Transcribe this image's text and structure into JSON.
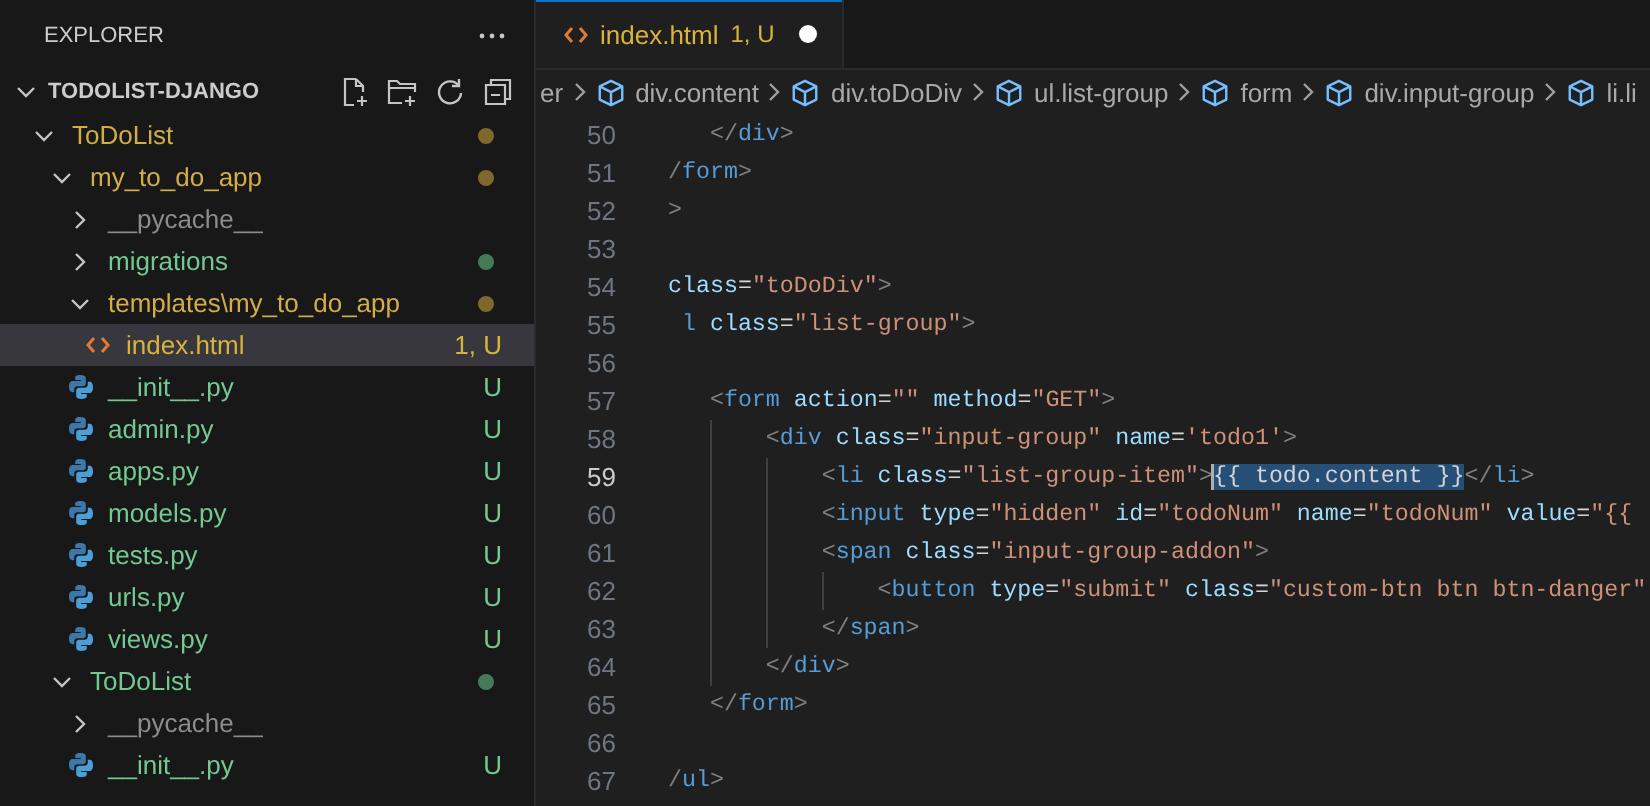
{
  "sidebar": {
    "title": "EXPLORER",
    "section": {
      "title": "TODOLIST-DJANGO",
      "expanded": true
    },
    "tree": [
      {
        "name": "ToDoList",
        "kind": "folder",
        "color": "#d2ad48",
        "expanded": true,
        "selected": false,
        "dot": true,
        "children": [
          {
            "name": "my_to_do_app",
            "kind": "folder",
            "color": "#d2ad48",
            "expanded": true,
            "selected": false,
            "dot": true,
            "children": [
              {
                "name": "__pycache__",
                "kind": "folder",
                "color": "#8c8c8c",
                "expanded": false,
                "selected": false,
                "dot": false
              },
              {
                "name": "migrations",
                "kind": "folder",
                "color": "#73c991",
                "expanded": false,
                "selected": false,
                "dot": true
              },
              {
                "name": "templates\\my_to_do_app",
                "kind": "folder",
                "color": "#d2ad48",
                "expanded": true,
                "selected": false,
                "dot": true,
                "children": [
                  {
                    "name": "index.html",
                    "kind": "html",
                    "color": "#d9b33c",
                    "selected": true,
                    "badge": "1, U"
                  }
                ]
              },
              {
                "name": "__init__.py",
                "kind": "python",
                "color": "#73c991",
                "selected": false,
                "badge": "U"
              },
              {
                "name": "admin.py",
                "kind": "python",
                "color": "#73c991",
                "selected": false,
                "badge": "U"
              },
              {
                "name": "apps.py",
                "kind": "python",
                "color": "#73c991",
                "selected": false,
                "badge": "U"
              },
              {
                "name": "models.py",
                "kind": "python",
                "color": "#73c991",
                "selected": false,
                "badge": "U"
              },
              {
                "name": "tests.py",
                "kind": "python",
                "color": "#73c991",
                "selected": false,
                "badge": "U"
              },
              {
                "name": "urls.py",
                "kind": "python",
                "color": "#73c991",
                "selected": false,
                "badge": "U"
              },
              {
                "name": "views.py",
                "kind": "python",
                "color": "#73c991",
                "selected": false,
                "badge": "U"
              }
            ]
          },
          {
            "name": "ToDoList",
            "kind": "folder",
            "color": "#73c991",
            "expanded": true,
            "selected": false,
            "dot": true,
            "children": [
              {
                "name": "__pycache__",
                "kind": "folder",
                "color": "#8c8c8c",
                "expanded": false,
                "selected": false,
                "dot": false
              },
              {
                "name": "__init__.py",
                "kind": "python",
                "color": "#73c991",
                "selected": false,
                "badge": "U"
              }
            ]
          }
        ]
      }
    ]
  },
  "tabs": [
    {
      "name": "index.html",
      "badge": "1, U",
      "color": "#d9b33c",
      "modified": true,
      "selected": true
    }
  ],
  "breadcrumbs": [
    {
      "text": "er",
      "icon": false
    },
    {
      "text": "div.content",
      "icon": true
    },
    {
      "text": "div.toDoDiv",
      "icon": true
    },
    {
      "text": "ul.list-group",
      "icon": true
    },
    {
      "text": "form",
      "icon": true
    },
    {
      "text": "div.input-group",
      "icon": true
    },
    {
      "text": "li.li",
      "icon": true
    }
  ],
  "editor": {
    "lines": [
      {
        "number": "50",
        "active": false,
        "tokens": [
          {
            "kind": "punct",
            "text": "   </"
          },
          {
            "kind": "tag",
            "text": "div"
          },
          {
            "kind": "punct",
            "text": ">"
          }
        ]
      },
      {
        "number": "51",
        "active": false,
        "tokens": [
          {
            "kind": "punct",
            "text": "/"
          },
          {
            "kind": "tag",
            "text": "form"
          },
          {
            "kind": "punct",
            "text": ">"
          }
        ]
      },
      {
        "number": "52",
        "active": false,
        "tokens": [
          {
            "kind": "punct",
            "text": ">"
          }
        ]
      },
      {
        "number": "53",
        "active": false
      },
      {
        "number": "54",
        "active": false,
        "tokens": [
          {
            "kind": "attr",
            "text": "class"
          },
          {
            "kind": "plain",
            "text": "="
          },
          {
            "kind": "string",
            "text": "\"toDoDiv\""
          },
          {
            "kind": "punct",
            "text": ">"
          }
        ]
      },
      {
        "number": "55",
        "active": false,
        "tokens": [
          {
            "kind": "tag",
            "text": " l"
          },
          {
            "kind": "attr",
            "text": " class"
          },
          {
            "kind": "plain",
            "text": "="
          },
          {
            "kind": "string",
            "text": "\"list-group\""
          },
          {
            "kind": "punct",
            "text": ">"
          }
        ]
      },
      {
        "number": "56",
        "active": false
      },
      {
        "number": "57",
        "active": false,
        "tokens": [
          {
            "kind": "punct",
            "text": "   <"
          },
          {
            "kind": "tag",
            "text": "form"
          },
          {
            "kind": "attr",
            "text": " action"
          },
          {
            "kind": "plain",
            "text": "="
          },
          {
            "kind": "string",
            "text": "\"\""
          },
          {
            "kind": "attr",
            "text": " method"
          },
          {
            "kind": "plain",
            "text": "="
          },
          {
            "kind": "string",
            "text": "\"GET\""
          },
          {
            "kind": "punct",
            "text": ">"
          }
        ]
      },
      {
        "number": "58",
        "active": false,
        "tokens": [
          {
            "kind": "punct",
            "text": "       <"
          },
          {
            "kind": "tag",
            "text": "div"
          },
          {
            "kind": "attr",
            "text": " class"
          },
          {
            "kind": "plain",
            "text": "="
          },
          {
            "kind": "string",
            "text": "\"input-group\""
          },
          {
            "kind": "attr",
            "text": " name"
          },
          {
            "kind": "plain",
            "text": "="
          },
          {
            "kind": "string",
            "text": "'todo1'"
          },
          {
            "kind": "punct",
            "text": ">"
          }
        ]
      },
      {
        "number": "59",
        "active": true,
        "tokens": [
          {
            "kind": "punct",
            "text": "           <"
          },
          {
            "kind": "tag",
            "text": "li"
          },
          {
            "kind": "attr",
            "text": " class"
          },
          {
            "kind": "plain",
            "text": "="
          },
          {
            "kind": "string",
            "text": "\"list-group-item\""
          },
          {
            "kind": "punct",
            "text": ">"
          },
          {
            "kind": "selection",
            "text": "{{ todo.content }}"
          },
          {
            "kind": "punct",
            "text": "</"
          },
          {
            "kind": "tag",
            "text": "li"
          },
          {
            "kind": "punct",
            "text": ">"
          }
        ]
      },
      {
        "number": "60",
        "active": false,
        "tokens": [
          {
            "kind": "punct",
            "text": "           <"
          },
          {
            "kind": "tag",
            "text": "input"
          },
          {
            "kind": "attr",
            "text": " type"
          },
          {
            "kind": "plain",
            "text": "="
          },
          {
            "kind": "string",
            "text": "\"hidden\""
          },
          {
            "kind": "attr",
            "text": " id"
          },
          {
            "kind": "plain",
            "text": "="
          },
          {
            "kind": "string",
            "text": "\"todoNum\""
          },
          {
            "kind": "attr",
            "text": " name"
          },
          {
            "kind": "plain",
            "text": "="
          },
          {
            "kind": "string",
            "text": "\"todoNum\""
          },
          {
            "kind": "attr",
            "text": " value"
          },
          {
            "kind": "plain",
            "text": "="
          },
          {
            "kind": "string",
            "text": "\"{{"
          }
        ]
      },
      {
        "number": "61",
        "active": false,
        "tokens": [
          {
            "kind": "punct",
            "text": "           <"
          },
          {
            "kind": "tag",
            "text": "span"
          },
          {
            "kind": "attr",
            "text": " class"
          },
          {
            "kind": "plain",
            "text": "="
          },
          {
            "kind": "string",
            "text": "\"input-group-addon\""
          },
          {
            "kind": "punct",
            "text": ">"
          }
        ]
      },
      {
        "number": "62",
        "active": false,
        "tokens": [
          {
            "kind": "punct",
            "text": "               <"
          },
          {
            "kind": "tag",
            "text": "button"
          },
          {
            "kind": "attr",
            "text": " type"
          },
          {
            "kind": "plain",
            "text": "="
          },
          {
            "kind": "string",
            "text": "\"submit\""
          },
          {
            "kind": "attr",
            "text": " class"
          },
          {
            "kind": "plain",
            "text": "="
          },
          {
            "kind": "string",
            "text": "\"custom-btn btn btn-danger\""
          }
        ]
      },
      {
        "number": "63",
        "active": false,
        "tokens": [
          {
            "kind": "punct",
            "text": "           </"
          },
          {
            "kind": "tag",
            "text": "span"
          },
          {
            "kind": "punct",
            "text": ">"
          }
        ]
      },
      {
        "number": "64",
        "active": false,
        "tokens": [
          {
            "kind": "punct",
            "text": "       </"
          },
          {
            "kind": "tag",
            "text": "div"
          },
          {
            "kind": "punct",
            "text": ">"
          }
        ]
      },
      {
        "number": "65",
        "active": false,
        "tokens": [
          {
            "kind": "punct",
            "text": "   </"
          },
          {
            "kind": "tag",
            "text": "form"
          },
          {
            "kind": "punct",
            "text": ">"
          }
        ]
      },
      {
        "number": "66",
        "active": false
      },
      {
        "number": "67",
        "active": false,
        "tokens": [
          {
            "kind": "punct",
            "text": "/"
          },
          {
            "kind": "tag",
            "text": "ul"
          },
          {
            "kind": "punct",
            "text": ">"
          }
        ]
      }
    ]
  }
}
